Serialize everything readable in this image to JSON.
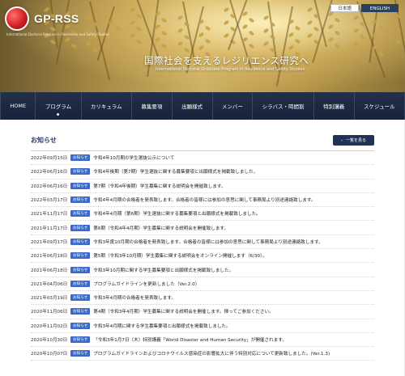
{
  "header": {
    "logo_text": "GP-RSS",
    "logo_subtitle": "International Doctoral Program in Resilience and Safety Studies",
    "lang_jp": "日本語",
    "lang_en": "ENGLISH",
    "title": "国際社会を支えるレジリエンス研究へ",
    "subtitle": "International Doctoral Graduate Program in Resilience and Safety Studies"
  },
  "nav": {
    "items": [
      {
        "label": "HOME"
      },
      {
        "label": "プログラム"
      },
      {
        "label": "カリキュラム"
      },
      {
        "label": "募集要項"
      },
      {
        "label": "出願様式"
      },
      {
        "label": "メンバー"
      },
      {
        "label": "シラバス・時間割"
      },
      {
        "label": "特別講義"
      },
      {
        "label": "スケジュール"
      }
    ]
  },
  "news": {
    "title": "お知らせ",
    "view_all": "一覧を見る",
    "items": [
      {
        "date": "2022年09月15日",
        "badge": "お知らせ",
        "text": "令和4年10月期の学生選抜公示について"
      },
      {
        "date": "2022年06月16日",
        "badge": "お知らせ",
        "text": "令和4年後期（第7期）学生選抜に関する募集要項と出願様式を掲載致しました。"
      },
      {
        "date": "2022年06月16日",
        "badge": "お知らせ",
        "text": "第7期（令和4年後期）学生募集に関する説明会を開催致します。"
      },
      {
        "date": "2022年03月17日",
        "badge": "お知らせ",
        "text": "令和4年4月期の合格者を発表致します。合格者の皆様には参加の意思に関して事務局より別途連絡致します。"
      },
      {
        "date": "2021年11月17日",
        "badge": "お知らせ",
        "text": "令和4年4月期（第6期）学生選抜に関する募集要項と出願様式を掲載致しました。"
      },
      {
        "date": "2021年11月17日",
        "badge": "お知らせ",
        "text": "第6期（令和4年4月期）学生募集に関する説明会を開催致します。"
      },
      {
        "date": "2021年09月17日",
        "badge": "お知らせ",
        "text": "令和3年度10月期の合格者を発表致します。合格者の皆様には参加の意思に関して事務局より別途連絡致します。"
      },
      {
        "date": "2021年06月18日",
        "badge": "お知らせ",
        "text": "第5期（令和3年10月期）学生募集に関する説明会をオンライン開催します（6/30）。"
      },
      {
        "date": "2021年06月18日",
        "badge": "お知らせ",
        "text": "令和3年10月期に関する学生募集要項と出願様式を掲載致しました。"
      },
      {
        "date": "2021年04月06日",
        "badge": "お知らせ",
        "text": "プログラムガイドラインを更新しました（Ver.2.0）"
      },
      {
        "date": "2021年03月19日",
        "badge": "お知らせ",
        "text": "令和3年4月期の合格者を発表致します。"
      },
      {
        "date": "2020年11月06日",
        "badge": "お知らせ",
        "text": "第4期（令和3年4月期）学生募集に関する説明会を開催します。揮ってご参加ください。"
      },
      {
        "date": "2020年11月02日",
        "badge": "お知らせ",
        "text": "令和3年4月期に関する学生募集要項と出願様式を掲載致しました。"
      },
      {
        "date": "2020年10月30日",
        "badge": "お知らせ",
        "text": "「令和3年1月7日（木）特別講義「World Disaster and Human Security」が開催されます。"
      },
      {
        "date": "2020年10月07日",
        "badge": "お知らせ",
        "text": "プログラムガイドラインおよびコロナウイルス感染症の影響拡大に伴う特別対応について更新致しました。(Ver.1.3)"
      }
    ]
  },
  "colors": {
    "nav_bg": "#1c2740",
    "badge": "#3b69c6",
    "title": "#2b3f5e",
    "button": "#1f3358"
  }
}
